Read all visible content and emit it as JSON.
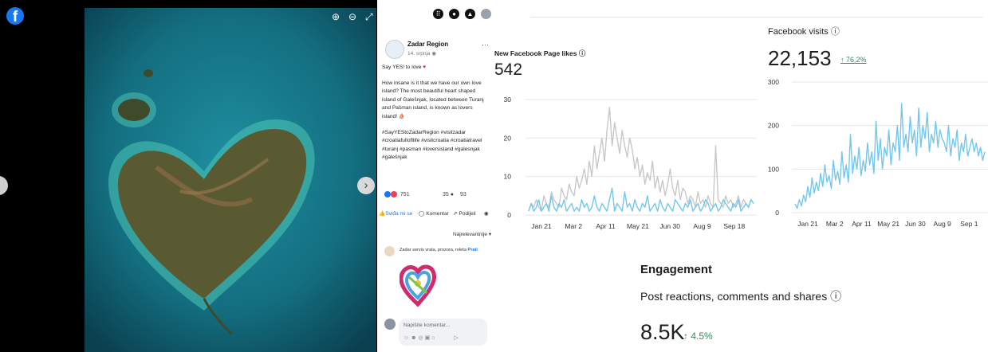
{
  "viewer": {
    "zoom_in_icon": "zoom-in-icon",
    "zoom_out_icon": "zoom-out-icon",
    "fullscreen_icon": "fullscreen-icon",
    "photo_subject": "heart-shaped island"
  },
  "post": {
    "page_name": "Zadar Region",
    "date": "14. srpnja",
    "line1": "Say YES! to love",
    "body": "How insane is it that we have our own love island? The most beautiful heart shaped island of Galešnjak, located between Turanj and Pašman island, is known as lovers island!",
    "hashtags": "#SayYEStoZadarRegion #visitzadar #croatiafullofllife #visitcroatia #croatiatravel #turanj #pasman #loversisland #galesnjak #galešnjak",
    "reactions_count": "751",
    "comments_count": "35",
    "shares_count": "93",
    "like_label": "Sviđa mi se",
    "comment_label": "Komentar",
    "share_label": "Podijeli",
    "sort_label": "Najrelevantnije",
    "comment_text": "Zadar servis vrata, prozora, roleta",
    "comment_follow": "Prati",
    "input_placeholder": "Napišite komentar..."
  },
  "insights": {
    "likes_title": "New Facebook Page likes",
    "likes_value": "542",
    "visits_title": "Facebook visits",
    "visits_value": "22,153",
    "visits_delta": "↑ 76.2%",
    "engagement_heading": "Engagement",
    "engagement_subtitle": "Post reactions, comments and shares",
    "engagement_value": "8.5K",
    "engagement_delta": "↑ 4.5%"
  },
  "chart_data": [
    {
      "type": "line",
      "title": "New Facebook Page likes",
      "x_ticks": [
        "Jan 21",
        "Mar 2",
        "Apr 11",
        "May 21",
        "Jun 30",
        "Aug 9",
        "Sep 18"
      ],
      "ylim": [
        0,
        30
      ],
      "y_ticks": [
        0,
        10,
        20,
        30
      ],
      "grid": true,
      "series": [
        {
          "color": "#c8c8c8",
          "values": [
            1,
            3,
            2,
            4,
            2,
            1,
            5,
            3,
            2,
            6,
            4,
            3,
            2,
            7,
            5,
            4,
            8,
            6,
            5,
            10,
            7,
            9,
            12,
            8,
            14,
            10,
            18,
            12,
            16,
            20,
            14,
            22,
            28,
            18,
            24,
            20,
            16,
            22,
            18,
            15,
            20,
            17,
            12,
            15,
            10,
            13,
            8,
            11,
            9,
            14,
            7,
            10,
            6,
            9,
            5,
            8,
            12,
            7,
            5,
            9,
            4,
            7,
            6,
            3,
            5,
            4,
            2,
            6,
            3,
            4,
            2,
            5,
            3,
            2,
            18,
            4,
            3,
            2,
            5,
            3,
            4,
            2,
            3,
            5,
            2,
            4,
            3,
            2,
            4,
            3
          ]
        },
        {
          "color": "#74c7ec",
          "values": [
            1,
            3,
            1,
            2,
            4,
            1,
            2,
            3,
            1,
            5,
            2,
            1,
            3,
            2,
            4,
            1,
            2,
            3,
            1,
            2,
            1,
            4,
            2,
            3,
            1,
            2,
            5,
            2,
            1,
            3,
            2,
            1,
            4,
            7,
            1,
            3,
            2,
            1,
            6,
            2,
            3,
            1,
            4,
            2,
            1,
            3,
            2,
            5,
            1,
            2,
            3,
            1,
            4,
            2,
            1,
            3,
            2,
            1,
            4,
            3,
            2,
            1,
            3,
            2,
            4,
            1,
            2,
            3,
            1,
            2,
            4,
            3,
            1,
            2,
            3,
            1,
            2,
            4,
            3,
            2,
            1,
            3,
            2,
            4,
            1,
            2,
            3,
            2,
            4,
            3
          ]
        }
      ]
    },
    {
      "type": "line",
      "title": "Facebook visits",
      "x_ticks": [
        "Jan 21",
        "Mar 2",
        "Apr 11",
        "May 21",
        "Jun 30",
        "Aug 9",
        "Sep 1"
      ],
      "ylim": [
        0,
        300
      ],
      "y_ticks": [
        0,
        100,
        200,
        300
      ],
      "grid": true,
      "series": [
        {
          "color": "#74c7ec",
          "values": [
            20,
            10,
            30,
            15,
            40,
            25,
            60,
            35,
            80,
            45,
            70,
            50,
            90,
            60,
            110,
            70,
            85,
            55,
            120,
            75,
            95,
            65,
            140,
            80,
            110,
            70,
            180,
            90,
            130,
            100,
            150,
            85,
            120,
            95,
            160,
            110,
            140,
            90,
            210,
            120,
            170,
            100,
            150,
            130,
            190,
            110,
            160,
            140,
            200,
            120,
            250,
            150,
            180,
            140,
            220,
            160,
            190,
            130,
            240,
            150,
            200,
            170,
            230,
            140,
            180,
            160,
            210,
            150,
            190,
            170,
            160,
            140,
            200,
            130,
            170,
            150,
            190,
            120,
            160,
            140,
            180,
            130,
            150,
            170,
            140,
            160,
            130,
            150,
            120,
            140
          ]
        }
      ]
    }
  ]
}
